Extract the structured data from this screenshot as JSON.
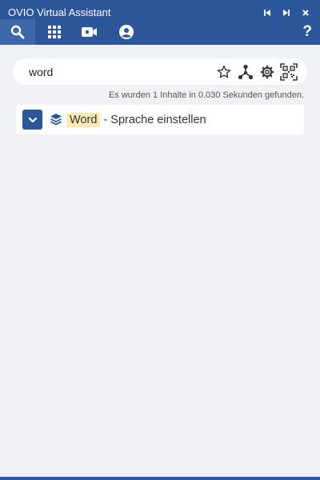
{
  "window": {
    "title": "OVIO Virtual Assistant",
    "controls": [
      "skip-back-icon",
      "skip-forward-icon",
      "close-icon"
    ]
  },
  "nav": {
    "tabs": [
      {
        "icon": "search-icon",
        "active": true
      },
      {
        "icon": "grid-icon",
        "active": false
      },
      {
        "icon": "video-camera-icon",
        "active": false
      },
      {
        "icon": "user-circle-icon",
        "active": false
      }
    ],
    "help_label": "?"
  },
  "search": {
    "value": "word",
    "placeholder": "",
    "tools": [
      "star-icon",
      "share-nodes-icon",
      "gear-icon",
      "qr-code-icon"
    ]
  },
  "status": {
    "text": "Es wurden 1 Inhalte in 0.030 Sekunden gefunden."
  },
  "results": [
    {
      "icon": "layers-icon",
      "highlight": "Word",
      "rest": " - Sprache einstellen"
    }
  ],
  "colors": {
    "brand": "#2b579a",
    "background": "#f0f1f4",
    "highlight": "#fce9b4"
  }
}
